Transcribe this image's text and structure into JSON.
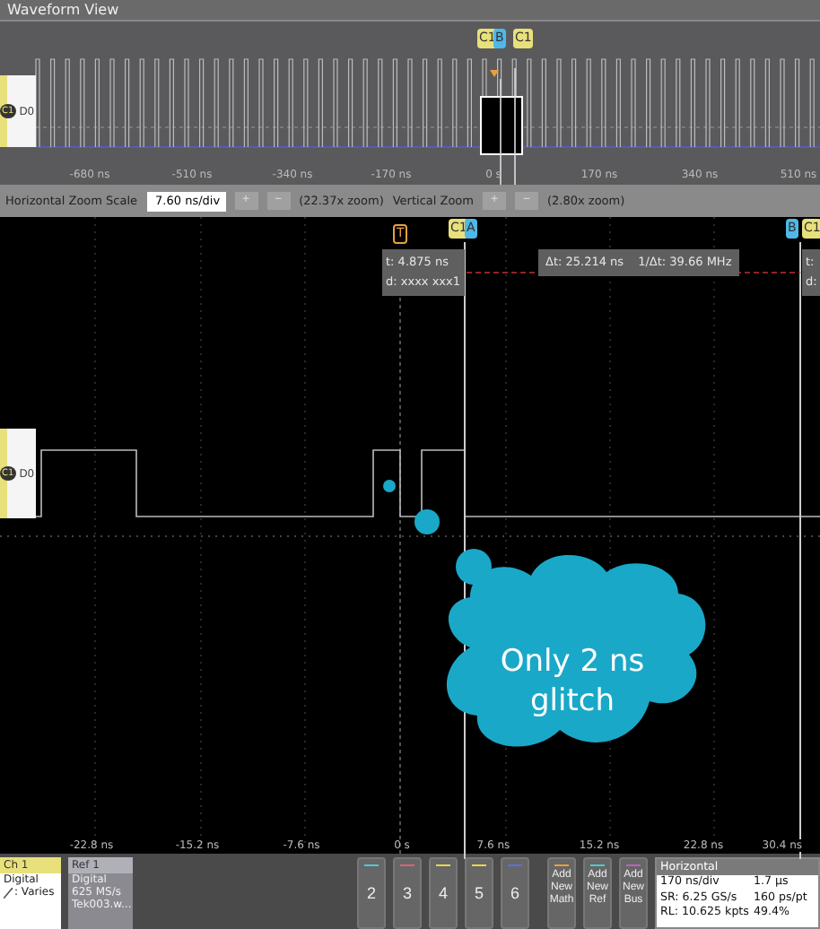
{
  "title": "Waveform View",
  "overview": {
    "channel_badge": "C1",
    "channel": "D0",
    "markers": [
      {
        "label": "C1",
        "kind": "cursor"
      },
      {
        "label": "B",
        "kind": "bus"
      },
      {
        "label": "C1",
        "kind": "cursor"
      }
    ],
    "ticks": [
      "-680 ns",
      "-510 ns",
      "-340 ns",
      "-170 ns",
      "0 s",
      "170 ns",
      "340 ns",
      "510 ns"
    ]
  },
  "zoom_bar": {
    "h_label": "Horizontal Zoom Scale",
    "h_value": "7.60 ns/div",
    "plus": "+",
    "minus": "−",
    "h_zoom": "(22.37x zoom)",
    "v_label": "Vertical Zoom",
    "v_zoom": "(2.80x zoom)"
  },
  "main": {
    "channel_badge": "C1",
    "channel": "D0",
    "trigger": "T",
    "cursor_a": [
      {
        "label": "C1",
        "kind": "cursor"
      },
      {
        "label": "A",
        "kind": "bus"
      }
    ],
    "cursor_b": [
      {
        "label": "B",
        "kind": "bus"
      },
      {
        "label": "C1",
        "kind": "cursor"
      }
    ],
    "readout_a": [
      "t: 4.875 ns",
      "d: xxxx xxx1"
    ],
    "delta": [
      "Δt: 25.214 ns",
      "1/Δt: 39.66 MHz"
    ],
    "readout_b": [
      "t:",
      "d:"
    ],
    "callout": "Only 2 ns glitch",
    "ticks": [
      "-22.8 ns",
      "-15.2 ns",
      "-7.6 ns",
      "0 s",
      "7.6 ns",
      "15.2 ns",
      "22.8 ns",
      "30.4 ns"
    ]
  },
  "bottom": {
    "ch": {
      "title": "Ch 1",
      "lines": [
        "Digital",
        ": Varies"
      ]
    },
    "ref": {
      "title": "Ref 1",
      "lines": [
        "Digital",
        "625 MS/s",
        "Tek003.w..."
      ]
    },
    "channels": [
      {
        "label": "2",
        "color": "#4fc9d0"
      },
      {
        "label": "3",
        "color": "#e0607a"
      },
      {
        "label": "4",
        "color": "#e8d84a"
      },
      {
        "label": "5",
        "color": "#e8d84a"
      },
      {
        "label": "6",
        "color": "#5a6ee0"
      }
    ],
    "add": [
      {
        "lines": [
          "Add",
          "New",
          "Math"
        ],
        "color": "#e8a040"
      },
      {
        "lines": [
          "Add",
          "New",
          "Ref"
        ],
        "color": "#4fc9d0"
      },
      {
        "lines": [
          "Add",
          "New",
          "Bus"
        ],
        "color": "#c060c0"
      }
    ],
    "horizontal": {
      "title": "Horizontal",
      "cells": [
        "170 ns/div",
        "1.7 µs",
        "SR: 6.25 GS/s",
        "160 ps/pt",
        "RL: 10.625 kpts",
        "49.4%"
      ]
    }
  }
}
